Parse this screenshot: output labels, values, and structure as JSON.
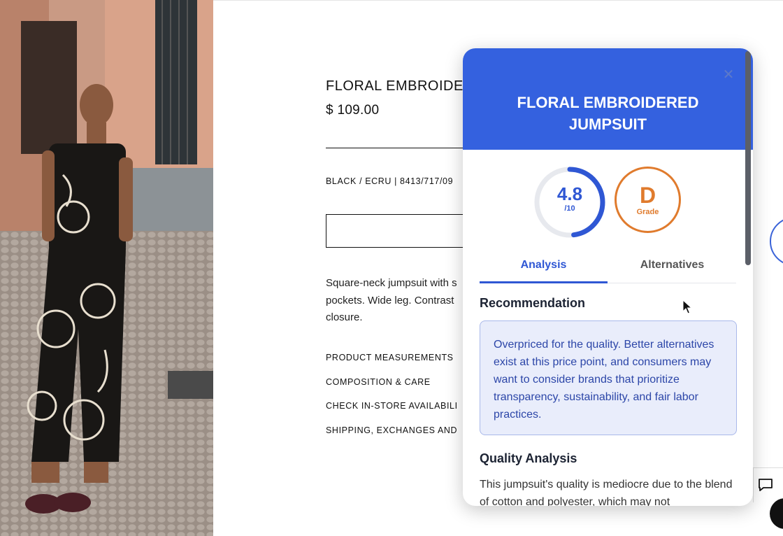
{
  "product": {
    "title": "FLORAL EMBROIDE",
    "price": "$ 109.00",
    "color_ref": "BLACK / ECRU | 8413/717/09",
    "description_lines": [
      "Square-neck jumpsuit with s",
      "pockets. Wide leg. Contrast",
      "closure."
    ],
    "links": [
      "PRODUCT MEASUREMENTS",
      "COMPOSITION & CARE",
      "CHECK IN-STORE AVAILABILI",
      "SHIPPING, EXCHANGES AND"
    ]
  },
  "panel": {
    "title": "FLORAL EMBROIDERED JUMPSUIT",
    "close_icon": "close-icon",
    "score": {
      "value": "4.8",
      "denominator": "/10",
      "fraction": 0.48
    },
    "grade": {
      "letter": "D",
      "label": "Grade"
    },
    "tabs": [
      {
        "label": "Analysis",
        "active": true
      },
      {
        "label": "Alternatives",
        "active": false
      }
    ],
    "recommendation": {
      "heading": "Recommendation",
      "text": "Overpriced for the quality. Better alternatives exist at this price point, and consumers may want to consider brands that prioritize transparency, sustainability, and fair labor practices."
    },
    "quality": {
      "heading": "Quality Analysis",
      "text": "This jumpsuit's quality is mediocre due to the blend of cotton and polyester, which may not"
    }
  },
  "colors": {
    "accent_blue": "#3461df",
    "grade_orange": "#e07b2d"
  },
  "icons": {
    "chat": "chat-icon",
    "cursor": "mouse-cursor-icon"
  }
}
